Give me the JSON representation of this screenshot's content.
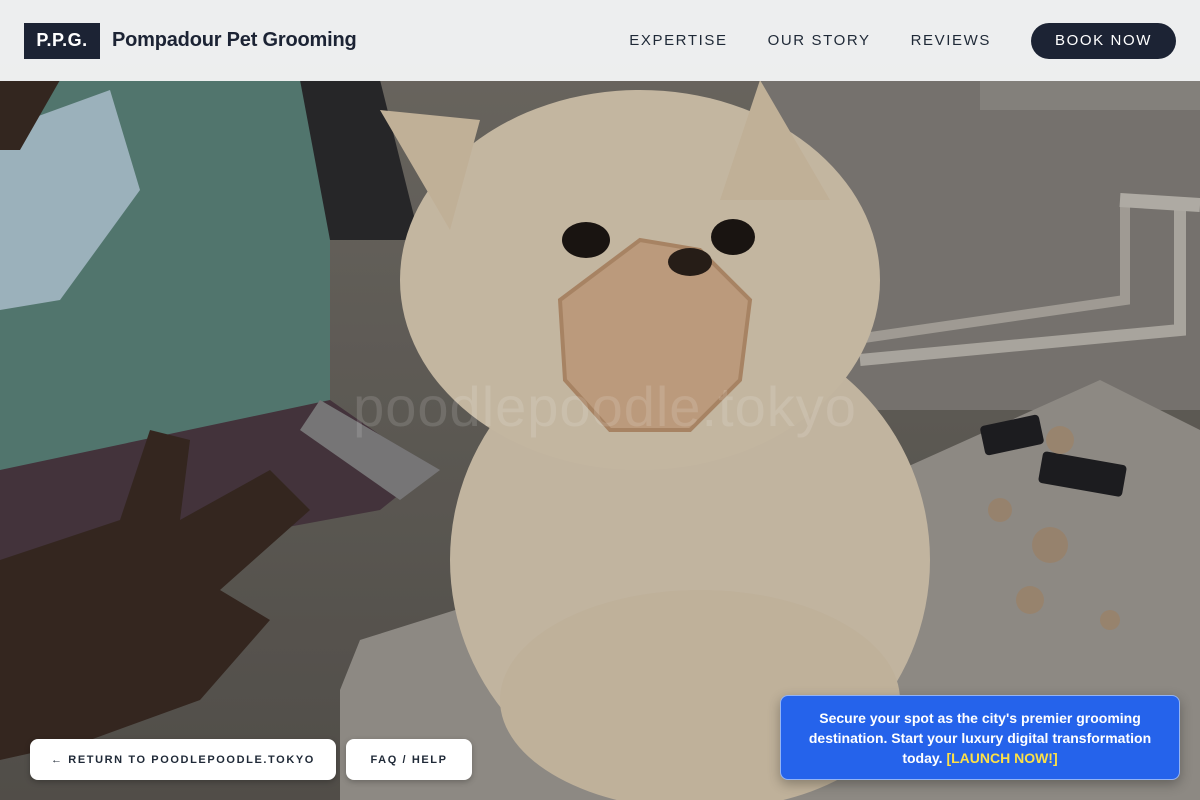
{
  "header": {
    "logo": "P.P.G.",
    "brand_name": "Pompadour Pet Grooming",
    "nav": {
      "expertise": "EXPERTISE",
      "our_story": "OUR STORY",
      "reviews": "REVIEWS"
    },
    "book_now": "BOOK NOW"
  },
  "hero": {
    "image": "pomeranian-with-muzzle-being-groomed-photo",
    "watermark": "poodlepoodle.tokyo"
  },
  "footer_buttons": {
    "return": "← RETURN TO POODLEPOODLE.TOKYO",
    "faq": "FAQ / HELP"
  },
  "promo": {
    "text": "Secure your spot as the city's premier grooming destination. Start your luxury digital transformation today.",
    "cta": "[LAUNCH NOW!]"
  },
  "colors": {
    "navy": "#1c2334",
    "header_bg": "#f3f4f5",
    "promo_blue": "#2563eb",
    "promo_cta": "#fde047"
  }
}
